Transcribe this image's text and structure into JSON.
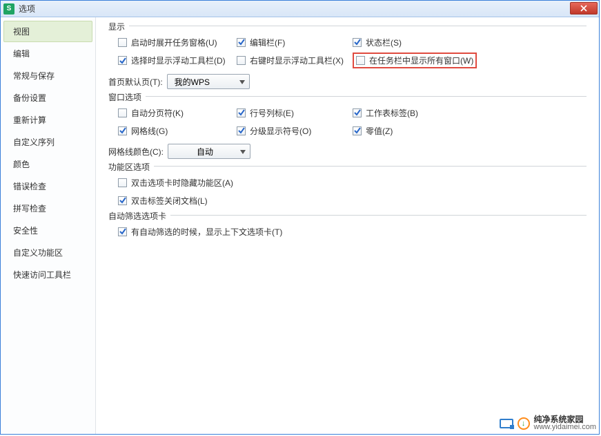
{
  "window": {
    "title": "选项"
  },
  "sidebar": {
    "items": [
      {
        "label": "视图",
        "active": true
      },
      {
        "label": "编辑"
      },
      {
        "label": "常规与保存"
      },
      {
        "label": "备份设置"
      },
      {
        "label": "重新计算"
      },
      {
        "label": "自定义序列"
      },
      {
        "label": "颜色"
      },
      {
        "label": "错误检查"
      },
      {
        "label": "拼写检查"
      },
      {
        "label": "安全性"
      },
      {
        "label": "自定义功能区"
      },
      {
        "label": "快速访问工具栏"
      }
    ]
  },
  "groups": {
    "display": {
      "title": "显示",
      "items": {
        "startup_task_pane": {
          "label": "启动时展开任务窗格(U)",
          "checked": false
        },
        "edit_bar": {
          "label": "编辑栏(F)",
          "checked": true
        },
        "status_bar": {
          "label": "状态栏(S)",
          "checked": true
        },
        "float_toolbar_select": {
          "label": "选择时显示浮动工具栏(D)",
          "checked": true
        },
        "float_toolbar_rightclick": {
          "label": "右键时显示浮动工具栏(X)",
          "checked": false
        },
        "show_windows_taskbar": {
          "label": "在任务栏中显示所有窗口(W)",
          "checked": false
        }
      },
      "default_page": {
        "label": "首页默认页(T):",
        "value": "我的WPS"
      }
    },
    "window_opts": {
      "title": "窗口选项",
      "items": {
        "auto_pagebreak": {
          "label": "自动分页符(K)",
          "checked": false
        },
        "row_col_header": {
          "label": "行号列标(E)",
          "checked": true
        },
        "sheet_tabs": {
          "label": "工作表标签(B)",
          "checked": true
        },
        "gridlines": {
          "label": "网格线(G)",
          "checked": true
        },
        "outline_symbols": {
          "label": "分级显示符号(O)",
          "checked": true
        },
        "zero_values": {
          "label": "零值(Z)",
          "checked": true
        }
      },
      "grid_color": {
        "label": "网格线颜色(C):",
        "value": "自动"
      }
    },
    "ribbon": {
      "title": "功能区选项",
      "items": {
        "dblclick_hide_ribbon": {
          "label": "双击选项卡时隐藏功能区(A)",
          "checked": false
        },
        "dblclick_close_doc": {
          "label": "双击标签关闭文档(L)",
          "checked": true
        }
      }
    },
    "autofilter": {
      "title": "自动筛选选项卡",
      "items": {
        "show_context_tab": {
          "label": "有自动筛选的时候，显示上下文选项卡(T)",
          "checked": true
        }
      }
    }
  },
  "watermark": {
    "name": "纯净系统家园",
    "url": "www.yidaimei.com"
  }
}
